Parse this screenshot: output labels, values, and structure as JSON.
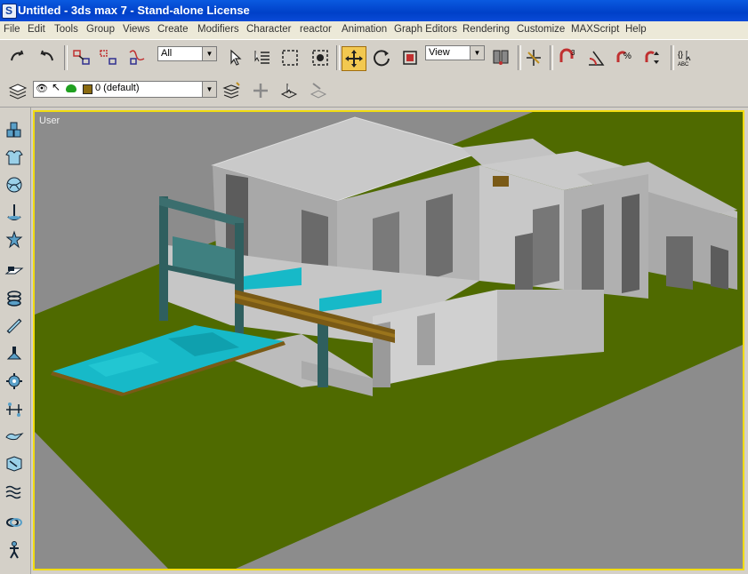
{
  "window": {
    "title": "Untitled - 3ds max 7  - Stand-alone License",
    "app_icon": "3ds-max-icon"
  },
  "menu": [
    "File",
    "Edit",
    "Tools",
    "Group",
    "Views",
    "Create",
    "Modifiers",
    "Character",
    "reactor",
    "Animation",
    "Graph Editors",
    "Rendering",
    "Customize",
    "MAXScript",
    "Help"
  ],
  "main_toolbar": {
    "selection_filter": "All",
    "reference_coord": "View"
  },
  "layer_toolbar": {
    "current_layer": "0 (default)"
  },
  "viewport": {
    "label": "User",
    "active_border_color": "#f2dc10",
    "ground_color": "#4f6a00",
    "background_color": "#8c8c8c"
  },
  "colors": {
    "titlebar": "#0a4bd8",
    "menubar": "#ece9d8",
    "toolbar": "#d4d0c8",
    "pool": "#17b9c8",
    "deck": "#7a5a16",
    "frame": "#2f5f5f"
  }
}
